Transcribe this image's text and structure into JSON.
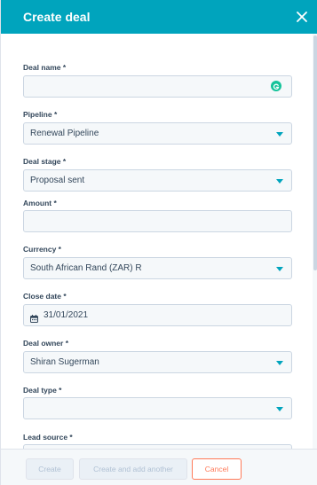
{
  "header": {
    "title": "Create deal"
  },
  "fields": [
    {
      "label": "Deal name *",
      "value": ""
    },
    {
      "label": "Pipeline *",
      "value": "Renewal Pipeline"
    },
    {
      "label": "Deal stage *",
      "value": "Proposal sent"
    },
    {
      "label": "Amount *",
      "value": ""
    },
    {
      "label": "Currency *",
      "value": "South African Rand (ZAR) R"
    },
    {
      "label": "Close date *",
      "value": "31/01/2021"
    },
    {
      "label": "Deal owner *",
      "value": "Shiran Sugerman"
    },
    {
      "label": "Deal type *",
      "value": ""
    },
    {
      "label": "Lead source *",
      "value": ""
    }
  ],
  "footer": {
    "create_label": "Create",
    "create_another_label": "Create and add another",
    "cancel_label": "Cancel"
  },
  "colors": {
    "accent": "#00a4bd",
    "cancel": "#ff7a59",
    "grammarly": "#15c39a"
  },
  "icons": {
    "close": "close-icon",
    "calendar": "calendar-icon",
    "dropdown": "chevron-down-icon",
    "grammarly": "grammarly-icon"
  }
}
